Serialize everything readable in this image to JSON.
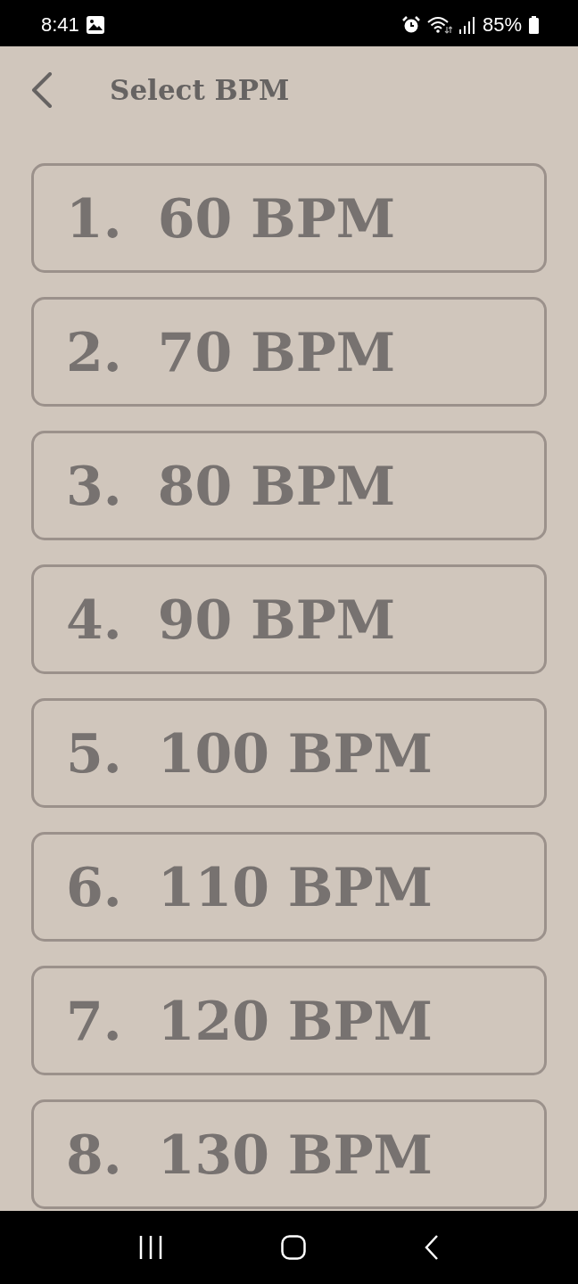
{
  "status_bar": {
    "time": "8:41",
    "battery": "85%"
  },
  "header": {
    "title": "Select BPM"
  },
  "options": [
    {
      "number": "1.",
      "label": "60 BPM"
    },
    {
      "number": "2.",
      "label": "70 BPM"
    },
    {
      "number": "3.",
      "label": "80 BPM"
    },
    {
      "number": "4.",
      "label": "90 BPM"
    },
    {
      "number": "5.",
      "label": "100 BPM"
    },
    {
      "number": "6.",
      "label": "110 BPM"
    },
    {
      "number": "7.",
      "label": "120 BPM"
    },
    {
      "number": "8.",
      "label": "130 BPM"
    }
  ]
}
